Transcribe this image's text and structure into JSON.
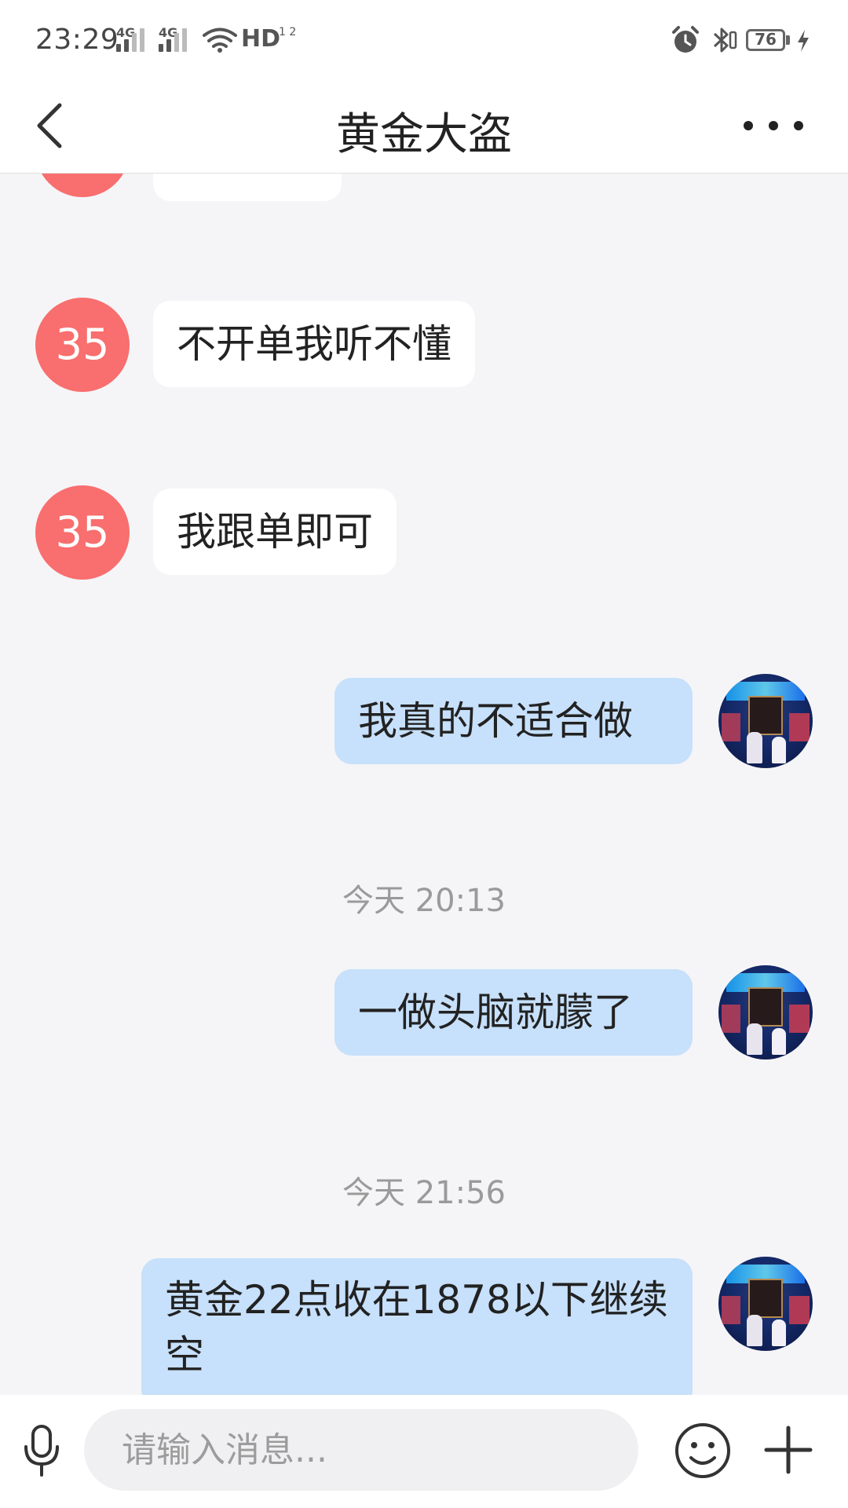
{
  "status_bar": {
    "time": "23:29",
    "network_1": "4G",
    "network_2": "4G",
    "hd": "HD",
    "hd_sub": "1 2",
    "battery": "76"
  },
  "header": {
    "title": "黄金大盗"
  },
  "messages": [
    {
      "side": "left",
      "avatar": "35",
      "text": "不开单我听不懂"
    },
    {
      "side": "left",
      "avatar": "35",
      "text": "我跟单即可"
    },
    {
      "side": "right",
      "text": "我真的不适合做"
    },
    {
      "type": "timestamp",
      "text": "今天 20:13"
    },
    {
      "side": "right",
      "text": "一做头脑就朦了"
    },
    {
      "type": "timestamp",
      "text": "今天 21:56"
    },
    {
      "side": "right",
      "text": "黄金22点收在1878以下继续空"
    }
  ],
  "input": {
    "placeholder": "请输入消息..."
  },
  "icons": {
    "back": "chevron-left-icon",
    "more": "more-horizontal-icon",
    "mic": "microphone-icon",
    "emoji": "smile-icon",
    "plus": "plus-icon"
  },
  "colors": {
    "avatar_35": "#f96e6e",
    "bubble_self": "#c7e0fb",
    "bubble_other": "#ffffff",
    "background": "#f5f5f7"
  }
}
